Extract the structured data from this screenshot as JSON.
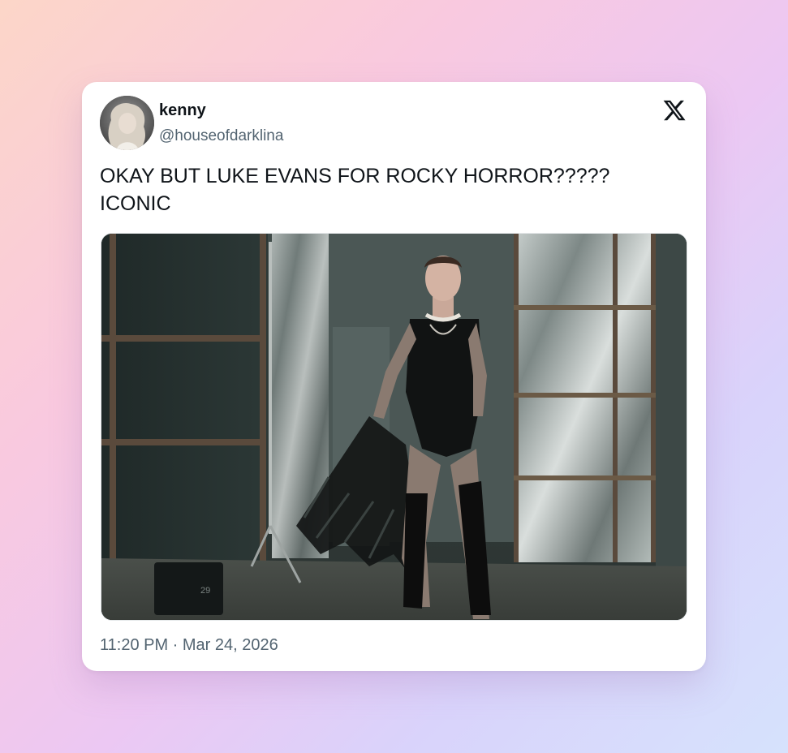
{
  "tweet": {
    "display_name": "kenny",
    "handle": "@houseofdarklina",
    "text": "OKAY BUT LUKE EVANS FOR ROCKY HORROR?????\nICONIC",
    "timestamp": "11:20 PM · Mar 24, 2026"
  },
  "icons": {
    "brand": "x-logo-icon",
    "avatar": "profile-avatar"
  },
  "colors": {
    "name": "#0f1419",
    "secondary": "#536471",
    "card_bg": "#ffffff"
  }
}
